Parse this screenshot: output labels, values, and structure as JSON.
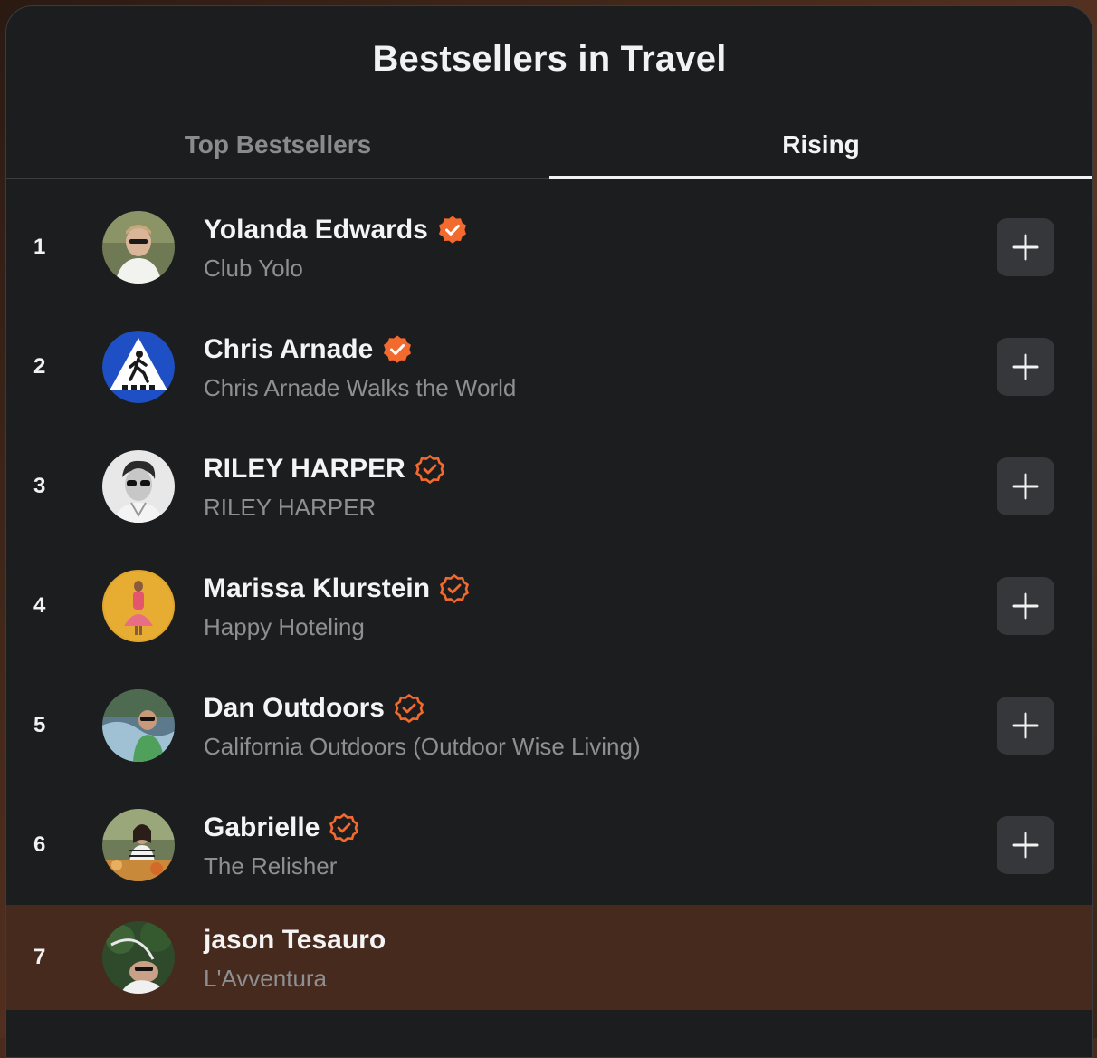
{
  "panel": {
    "title": "Bestsellers in Travel"
  },
  "tabs": [
    {
      "label": "Top Bestsellers",
      "active": false
    },
    {
      "label": "Rising",
      "active": true
    }
  ],
  "colors": {
    "accent": "#f26a2e",
    "panel_bg": "#1c1d1f",
    "highlight_row_bg": "#462a1d",
    "button_bg": "#36373a"
  },
  "rows": [
    {
      "rank": "1",
      "name": "Yolanda Edwards",
      "publication": "Club Yolo",
      "badge": "verified-filled",
      "has_add_button": true
    },
    {
      "rank": "2",
      "name": "Chris Arnade",
      "publication": "Chris Arnade Walks the World",
      "badge": "verified-filled",
      "has_add_button": true
    },
    {
      "rank": "3",
      "name": "RILEY HARPER",
      "publication": "RILEY HARPER",
      "badge": "verified-outline",
      "has_add_button": true
    },
    {
      "rank": "4",
      "name": "Marissa Klurstein",
      "publication": "Happy Hoteling",
      "badge": "verified-outline",
      "has_add_button": true
    },
    {
      "rank": "5",
      "name": "Dan Outdoors",
      "publication": "California Outdoors (Outdoor Wise Living)",
      "badge": "verified-outline",
      "has_add_button": true
    },
    {
      "rank": "6",
      "name": "Gabrielle",
      "publication": "The Relisher",
      "badge": "verified-outline",
      "has_add_button": true
    },
    {
      "rank": "7",
      "name": "jason Tesauro",
      "publication": "L'Avventura",
      "badge": "none",
      "has_add_button": false,
      "highlighted": true
    }
  ],
  "icons": {
    "add": "plus-icon",
    "verified": "verified-check-icon"
  }
}
